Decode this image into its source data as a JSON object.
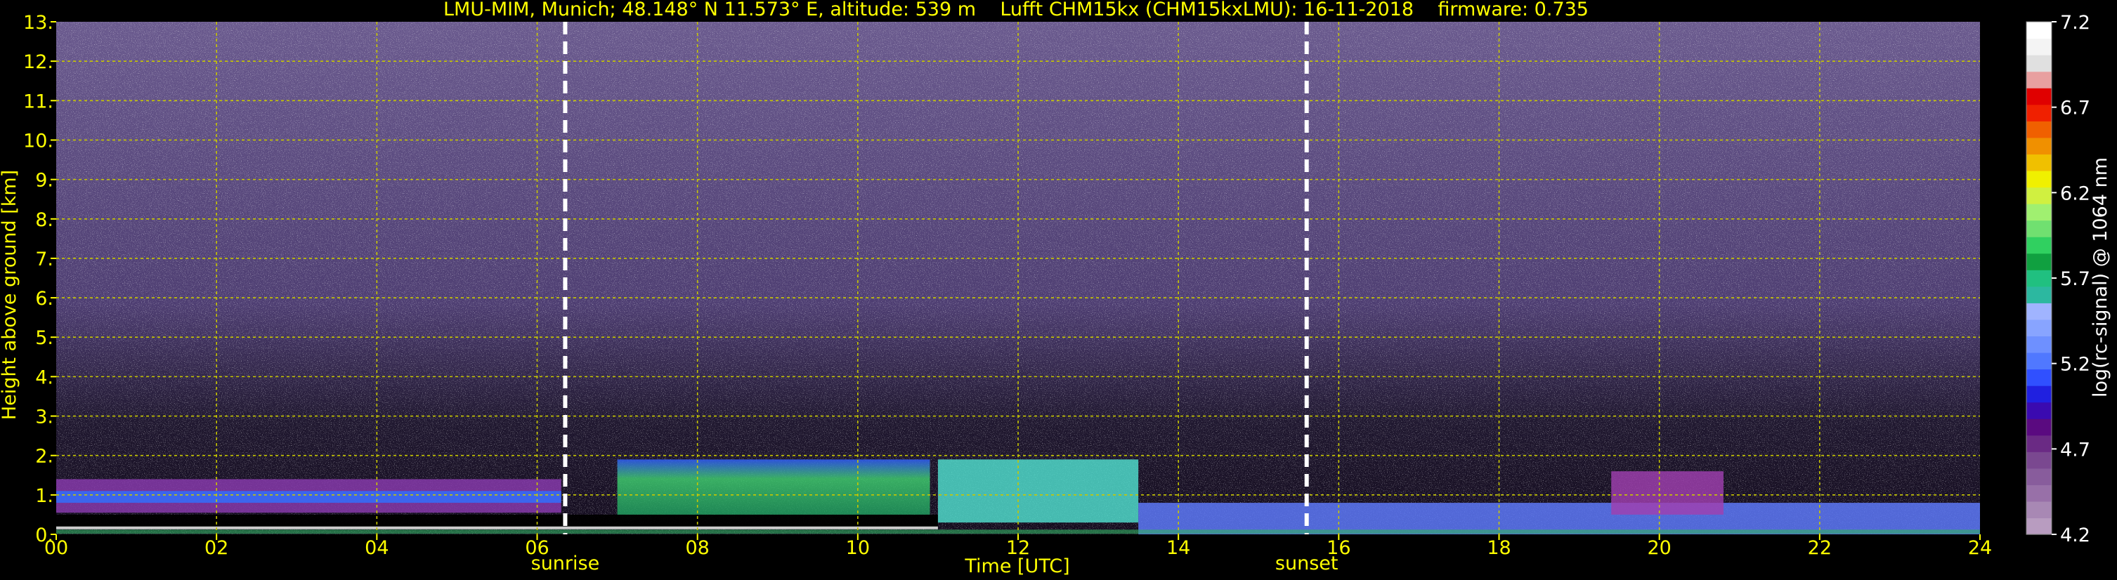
{
  "chart_data": {
    "type": "heatmap",
    "title": "LMU-MIM, Munich; 48.148° N 11.573° E, altitude: 539 m    Lufft CHM15kx (CHM15kxLMU): 16-11-2018    firmware: 0.735",
    "xlabel": "Time [UTC]",
    "ylabel": "Height above ground [km]",
    "xlim": [
      0,
      24
    ],
    "ylim": [
      0,
      13
    ],
    "x_ticks": [
      0,
      2,
      4,
      6,
      8,
      10,
      12,
      14,
      16,
      18,
      20,
      22,
      24
    ],
    "x_tick_labels": [
      "00",
      "02",
      "04",
      "06",
      "08",
      "10",
      "12",
      "14",
      "16",
      "18",
      "20",
      "22",
      "24"
    ],
    "y_ticks": [
      0,
      1,
      2,
      3,
      4,
      5,
      6,
      7,
      8,
      9,
      10,
      11,
      12,
      13
    ],
    "y_tick_labels": [
      "0.",
      "1.",
      "2.",
      "3.",
      "4.",
      "5.",
      "6.",
      "7.",
      "8.",
      "9.",
      "10.",
      "11.",
      "12.",
      "13."
    ],
    "grid": true,
    "grid_color": "#c8c800",
    "annotations": [
      {
        "label": "sunrise",
        "x": 6.35
      },
      {
        "label": "sunset",
        "x": 15.6
      }
    ],
    "colorbar": {
      "label": "log(rc-signal) @ 1064 nm",
      "range": [
        4.2,
        7.2
      ],
      "ticks": [
        4.2,
        4.7,
        5.2,
        5.7,
        6.2,
        6.7,
        7.2
      ],
      "tick_labels": [
        "4.2",
        "4.7",
        "5.2",
        "5.7",
        "6.2",
        "6.7",
        "7.2"
      ],
      "colors": [
        "#b89cc0",
        "#a888b4",
        "#9870a8",
        "#885c9c",
        "#7a4890",
        "#6a2a84",
        "#5a0a80",
        "#3a0ab0",
        "#2020e0",
        "#3050ff",
        "#5078ff",
        "#6e90ff",
        "#88a4ff",
        "#a0b4ff",
        "#2cb8a0",
        "#20c080",
        "#10a040",
        "#30d060",
        "#70e070",
        "#a0f070",
        "#d0f040",
        "#f0f000",
        "#f0c000",
        "#f09000",
        "#f06000",
        "#f02000",
        "#e00000",
        "#e8a0a0",
        "#e0e0e0",
        "#f4f4f4",
        "#ffffff"
      ]
    },
    "layers": [
      {
        "feature": "low residual layer",
        "x": [
          0,
          6.3
        ],
        "y": [
          0.55,
          1.4
        ],
        "color": "#8a3ab0"
      },
      {
        "feature": "blue aerosol band",
        "x": [
          0,
          6.3
        ],
        "y": [
          0.8,
          1.1
        ],
        "color": "#3070ff"
      },
      {
        "feature": "strong near-surface layer",
        "x": [
          0,
          11
        ],
        "y": [
          0.15,
          0.5
        ],
        "color": "#000000"
      },
      {
        "feature": "growing mixed layer",
        "x": [
          7,
          10.9
        ],
        "y": [
          0.5,
          1.9
        ],
        "color": "#30c060"
      },
      {
        "feature": "broken clouds",
        "x": [
          11,
          13.5
        ],
        "y": [
          0.3,
          1.9
        ],
        "color": "#50e0d0"
      },
      {
        "feature": "afternoon blue layer",
        "x": [
          13.5,
          24
        ],
        "y": [
          0,
          0.8
        ],
        "color": "#5f7cff"
      },
      {
        "feature": "evening cloud layer",
        "x": [
          19.4,
          20.8
        ],
        "y": [
          0.5,
          1.6
        ],
        "color": "#a040b0"
      }
    ]
  }
}
